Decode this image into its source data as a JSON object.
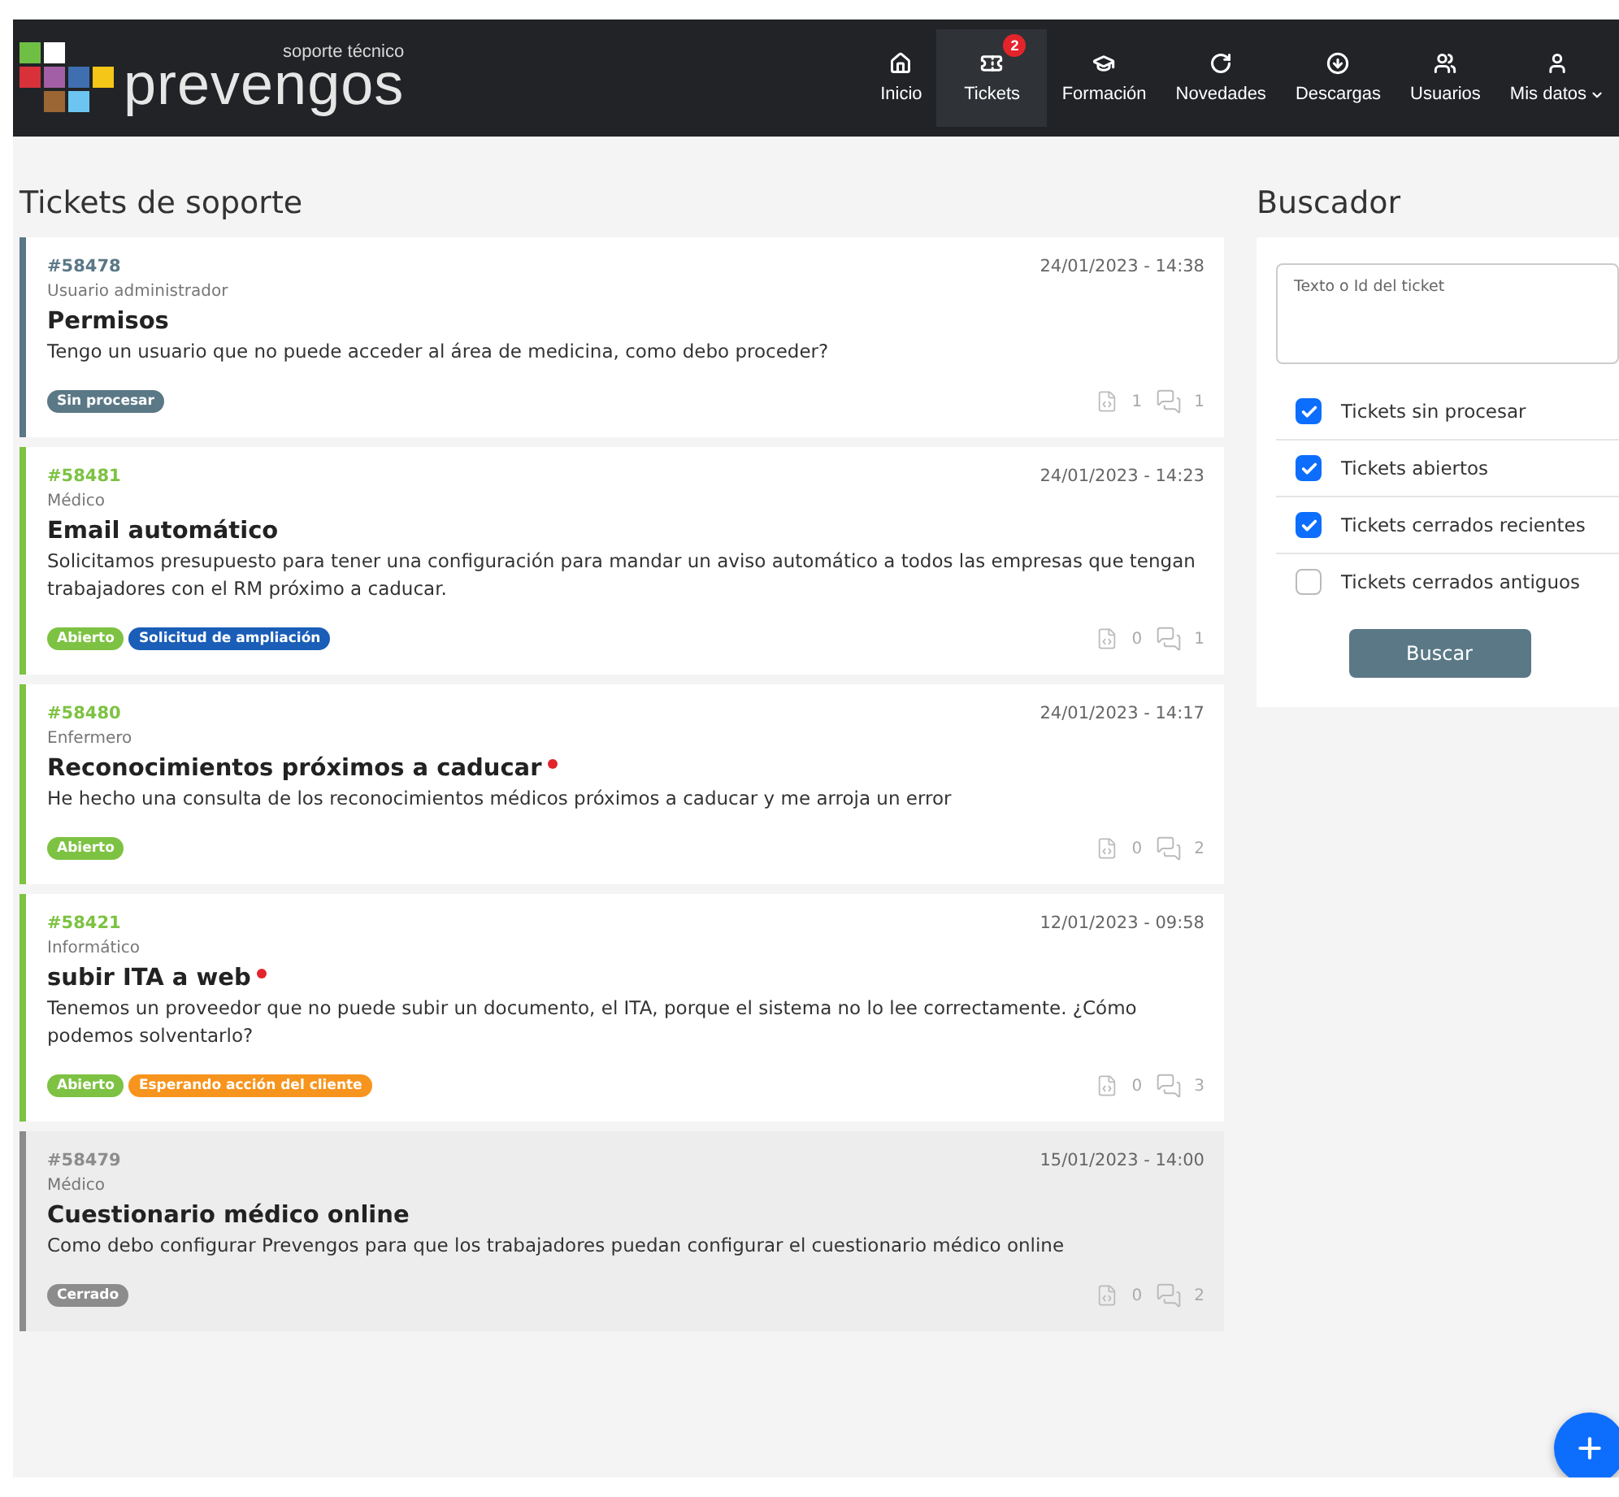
{
  "header": {
    "logo": {
      "tagline": "soporte técnico",
      "name": "prevengos"
    },
    "nav": [
      {
        "label": "Inicio",
        "selected": false
      },
      {
        "label": "Tickets",
        "selected": true,
        "badge": "2"
      },
      {
        "label": "Formación",
        "selected": false
      },
      {
        "label": "Novedades",
        "selected": false
      },
      {
        "label": "Descargas",
        "selected": false
      },
      {
        "label": "Usuarios",
        "selected": false
      },
      {
        "label": "Mis datos",
        "selected": false,
        "dropdown": true
      }
    ]
  },
  "tickets_title": "Tickets de soporte",
  "tickets": [
    {
      "id": "#58478",
      "role": "Usuario administrador",
      "date": "24/01/2023 - 14:38",
      "title": "Permisos",
      "unread": false,
      "description": "Tengo un usuario que no puede acceder al área de medicina, como debo proceder?",
      "color": "#5b7886",
      "closed": false,
      "tags": [
        {
          "label": "Sin procesar",
          "color": "#5b7886"
        }
      ],
      "attachments": "1",
      "comments": "1"
    },
    {
      "id": "#58481",
      "role": "Médico",
      "date": "24/01/2023 - 14:23",
      "title": "Email automático",
      "unread": false,
      "description": "Solicitamos presupuesto para tener una configuración para mandar un aviso automático a todos las empresas que tengan trabajadores con el RM próximo a caducar.",
      "color": "#7dc242",
      "closed": false,
      "tags": [
        {
          "label": "Abierto",
          "color": "#7dc242"
        },
        {
          "label": "Solicitud de ampliación",
          "color": "#1a5eb8"
        }
      ],
      "attachments": "0",
      "comments": "1"
    },
    {
      "id": "#58480",
      "role": "Enfermero",
      "date": "24/01/2023 - 14:17",
      "title": "Reconocimientos próximos a caducar",
      "unread": true,
      "description": "He hecho una consulta de los reconocimientos médicos próximos a caducar y me arroja un error",
      "color": "#7dc242",
      "closed": false,
      "tags": [
        {
          "label": "Abierto",
          "color": "#7dc242"
        }
      ],
      "attachments": "0",
      "comments": "2"
    },
    {
      "id": "#58421",
      "role": "Informático",
      "date": "12/01/2023 - 09:58",
      "title": "subir ITA a web",
      "unread": true,
      "description": "Tenemos un proveedor que no puede subir un documento, el ITA, porque el sistema no lo lee correctamente. ¿Cómo podemos solventarlo?",
      "color": "#7dc242",
      "closed": false,
      "tags": [
        {
          "label": "Abierto",
          "color": "#7dc242"
        },
        {
          "label": "Esperando acción del cliente",
          "color": "#f7941d"
        }
      ],
      "attachments": "0",
      "comments": "3"
    },
    {
      "id": "#58479",
      "role": "Médico",
      "date": "15/01/2023 - 14:00",
      "title": "Cuestionario médico online",
      "unread": false,
      "description": "Como debo configurar Prevengos para que los trabajadores puedan configurar el cuestionario médico online",
      "color": "#8c8c8c",
      "closed": true,
      "tags": [
        {
          "label": "Cerrado",
          "color": "#8c8c8c"
        }
      ],
      "attachments": "0",
      "comments": "2"
    }
  ],
  "search": {
    "title": "Buscador",
    "placeholder": "Texto o Id del ticket",
    "filters": [
      {
        "label": "Tickets sin procesar",
        "checked": true
      },
      {
        "label": "Tickets abiertos",
        "checked": true
      },
      {
        "label": "Tickets cerrados recientes",
        "checked": true
      },
      {
        "label": "Tickets cerrados antiguos",
        "checked": false
      }
    ],
    "button": "Buscar"
  }
}
